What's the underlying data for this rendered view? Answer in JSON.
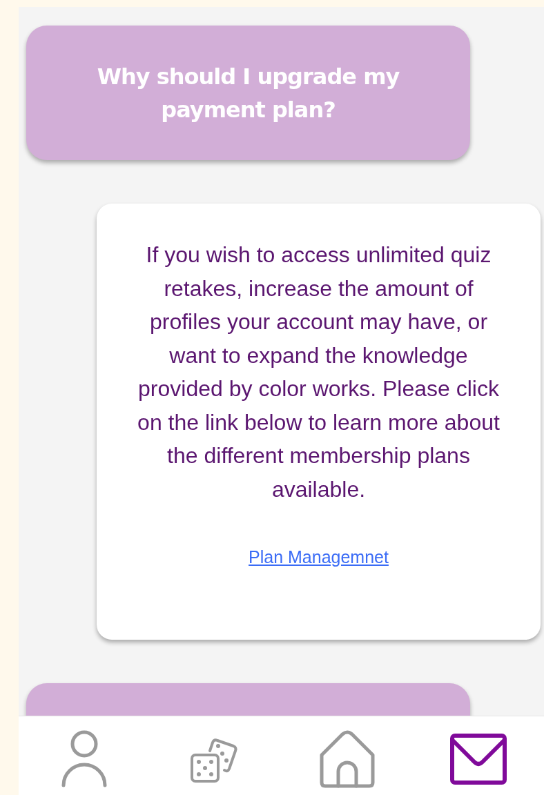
{
  "messages": [
    {
      "kind": "question",
      "text": "Why should I upgrade my payment plan?"
    },
    {
      "kind": "answer",
      "text": "If you wish to access unlimited quiz retakes, increase the amount of profiles your account may have, or want to expand the knowledge provided by color works. Please click on the link below to learn more about the different membership plans available.",
      "link": "Plan Managemnet"
    },
    {
      "kind": "question"
    }
  ],
  "nav": [
    {
      "kind": "profile",
      "selected": false
    },
    {
      "kind": "dice",
      "selected": false
    },
    {
      "kind": "home",
      "selected": false
    },
    {
      "kind": "mail",
      "selected": true
    }
  ]
}
